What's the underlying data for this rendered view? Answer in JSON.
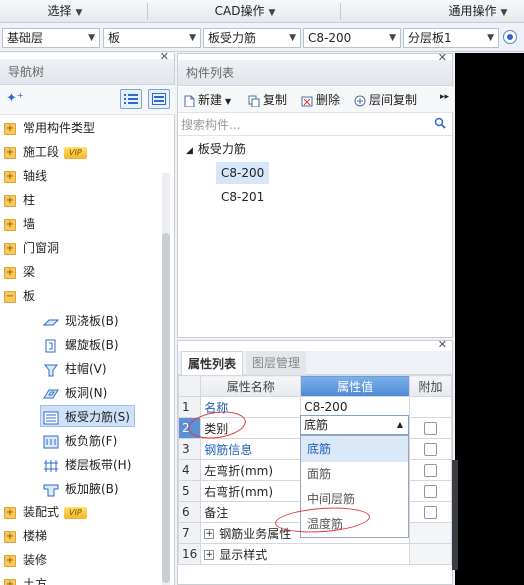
{
  "menubar": {
    "select": "选择",
    "cad": "CAD操作",
    "common": "通用操作"
  },
  "dropdowns": {
    "floor": "基础层",
    "category": "板",
    "type": "板受力筋",
    "component": "C8-200",
    "layer": "分层板1"
  },
  "nav": {
    "title": "导航树",
    "items": [
      {
        "label": "常用构件类型",
        "vip": ""
      },
      {
        "label": "施工段",
        "vip": "VIP"
      },
      {
        "label": "轴线",
        "vip": ""
      },
      {
        "label": "柱",
        "vip": ""
      },
      {
        "label": "墙",
        "vip": ""
      },
      {
        "label": "门窗洞",
        "vip": ""
      },
      {
        "label": "梁",
        "vip": ""
      },
      {
        "label": "板",
        "vip": ""
      }
    ],
    "slab_children": [
      "现浇板(B)",
      "螺旋板(B)",
      "柱帽(V)",
      "板洞(N)",
      "板受力筋(S)",
      "板负筋(F)",
      "楼层板带(H)",
      "板加腋(B)"
    ],
    "after": [
      {
        "label": "装配式",
        "vip": "VIP"
      },
      {
        "label": "楼梯",
        "vip": ""
      },
      {
        "label": "装修",
        "vip": ""
      },
      {
        "label": "土方",
        "vip": ""
      }
    ]
  },
  "component_list": {
    "title": "构件列表",
    "toolbar": {
      "new": "新建",
      "copy": "复制",
      "delete": "删除",
      "layer_copy": "层间复制"
    },
    "search_placeholder": "搜索构件...",
    "root": "板受力筋",
    "items": [
      "C8-200",
      "C8-201"
    ]
  },
  "properties": {
    "tabs": [
      "属性列表",
      "图层管理"
    ],
    "headers": {
      "name": "属性名称",
      "value": "属性值",
      "extra": "附加"
    },
    "rows": [
      {
        "num": "1",
        "name": "名称",
        "value": "C8-200"
      },
      {
        "num": "2",
        "name": "类别",
        "value": "底筋"
      },
      {
        "num": "3",
        "name": "钢筋信息",
        "value": ""
      },
      {
        "num": "4",
        "name": "左弯折(mm)",
        "value": ""
      },
      {
        "num": "5",
        "name": "右弯折(mm)",
        "value": ""
      },
      {
        "num": "6",
        "name": "备注",
        "value": ""
      },
      {
        "num": "7",
        "name": "钢筋业务属性",
        "value": ""
      },
      {
        "num": "16",
        "name": "显示样式",
        "value": ""
      }
    ],
    "dropdown_options": [
      "底筋",
      "面筋",
      "中间层筋",
      "温度筋"
    ]
  },
  "colors": {
    "accent": "#4d8ad6",
    "annotation": "#e03a3a",
    "selected": "#cfe1f7"
  }
}
